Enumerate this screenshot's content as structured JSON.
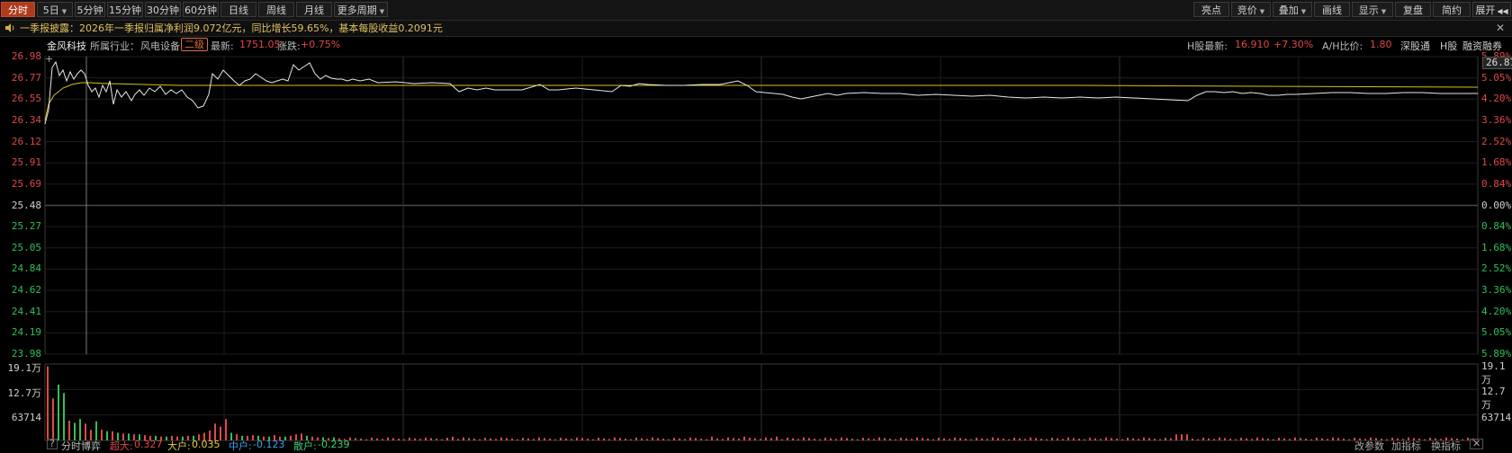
{
  "toolbar": {
    "periods": [
      {
        "label": "分时",
        "active": true,
        "dropdown": false
      },
      {
        "label": "5日",
        "active": false,
        "dropdown": true
      },
      {
        "label": "5分钟",
        "active": false,
        "dropdown": false
      },
      {
        "label": "15分钟",
        "active": false,
        "dropdown": false
      },
      {
        "label": "30分钟",
        "active": false,
        "dropdown": false
      },
      {
        "label": "60分钟",
        "active": false,
        "dropdown": false
      },
      {
        "label": "日线",
        "active": false,
        "dropdown": false
      },
      {
        "label": "周线",
        "active": false,
        "dropdown": false
      },
      {
        "label": "月线",
        "active": false,
        "dropdown": false
      },
      {
        "label": "更多周期",
        "active": false,
        "dropdown": true
      }
    ],
    "right": [
      {
        "label": "亮点",
        "dropdown": false
      },
      {
        "label": "竞价",
        "dropdown": true
      },
      {
        "label": "叠加",
        "dropdown": true
      },
      {
        "label": "画线",
        "dropdown": false
      },
      {
        "label": "显示",
        "dropdown": true
      },
      {
        "label": "复盘",
        "dropdown": false
      },
      {
        "label": "简约",
        "dropdown": false
      },
      {
        "label": "展开",
        "dropdown": false
      }
    ]
  },
  "news": {
    "text": "一季报披露：2026年一季报归属净利润9.072亿元，同比增长59.65%，基本每股收益0.2091元",
    "close": "✕"
  },
  "info": {
    "stock_name": "金风科技",
    "industry_label": "所属行业：",
    "industry": "风电设备",
    "level_badge": "二级",
    "latest_label": "最新:",
    "latest": "1751.05",
    "change_label": "涨跌:",
    "change": "+0.75%",
    "h_label": "H股最新:",
    "h_price": "16.910",
    "h_change": "+7.30%",
    "ah_label": "A/H比价:",
    "ah_value": "1.80",
    "link_sgt": "深股通",
    "link_h": "H股",
    "link_margin": "融资融券"
  },
  "price_axis": {
    "left": [
      "26.98",
      "26.77",
      "26.55",
      "26.34",
      "26.12",
      "25.91",
      "25.69",
      "25.48",
      "25.27",
      "25.05",
      "24.84",
      "24.62",
      "24.41",
      "24.19",
      "23.98"
    ],
    "right": [
      "5.89%",
      "5.05%",
      "4.20%",
      "3.36%",
      "2.52%",
      "1.68%",
      "0.84%",
      "0.00%",
      "0.84%",
      "1.68%",
      "2.52%",
      "3.36%",
      "4.20%",
      "5.05%",
      "5.89%"
    ],
    "current_tag": "26.87"
  },
  "volume_axis": {
    "labels": [
      "19.1万",
      "12.7万",
      "63714"
    ]
  },
  "bottom": {
    "help": "?",
    "tab": "分时博弈",
    "super_label": "超大:",
    "super_value": "0.327",
    "large_label": "大户:",
    "large_value": "0.035",
    "medium_label": "中户:",
    "medium_value": "-0.123",
    "retail_label": "散户:",
    "retail_value": "-0.239",
    "change_params": "改参数",
    "add_indicator": "加指标",
    "switch_indicator": "换指标",
    "close": "✕"
  },
  "colors": {
    "up": "#e04848",
    "down": "#2fc05a",
    "price_line": "#e8e8e8",
    "avg_line": "#d8c020",
    "grid": "#1e1e1e",
    "accent": "#b03a1e"
  }
}
